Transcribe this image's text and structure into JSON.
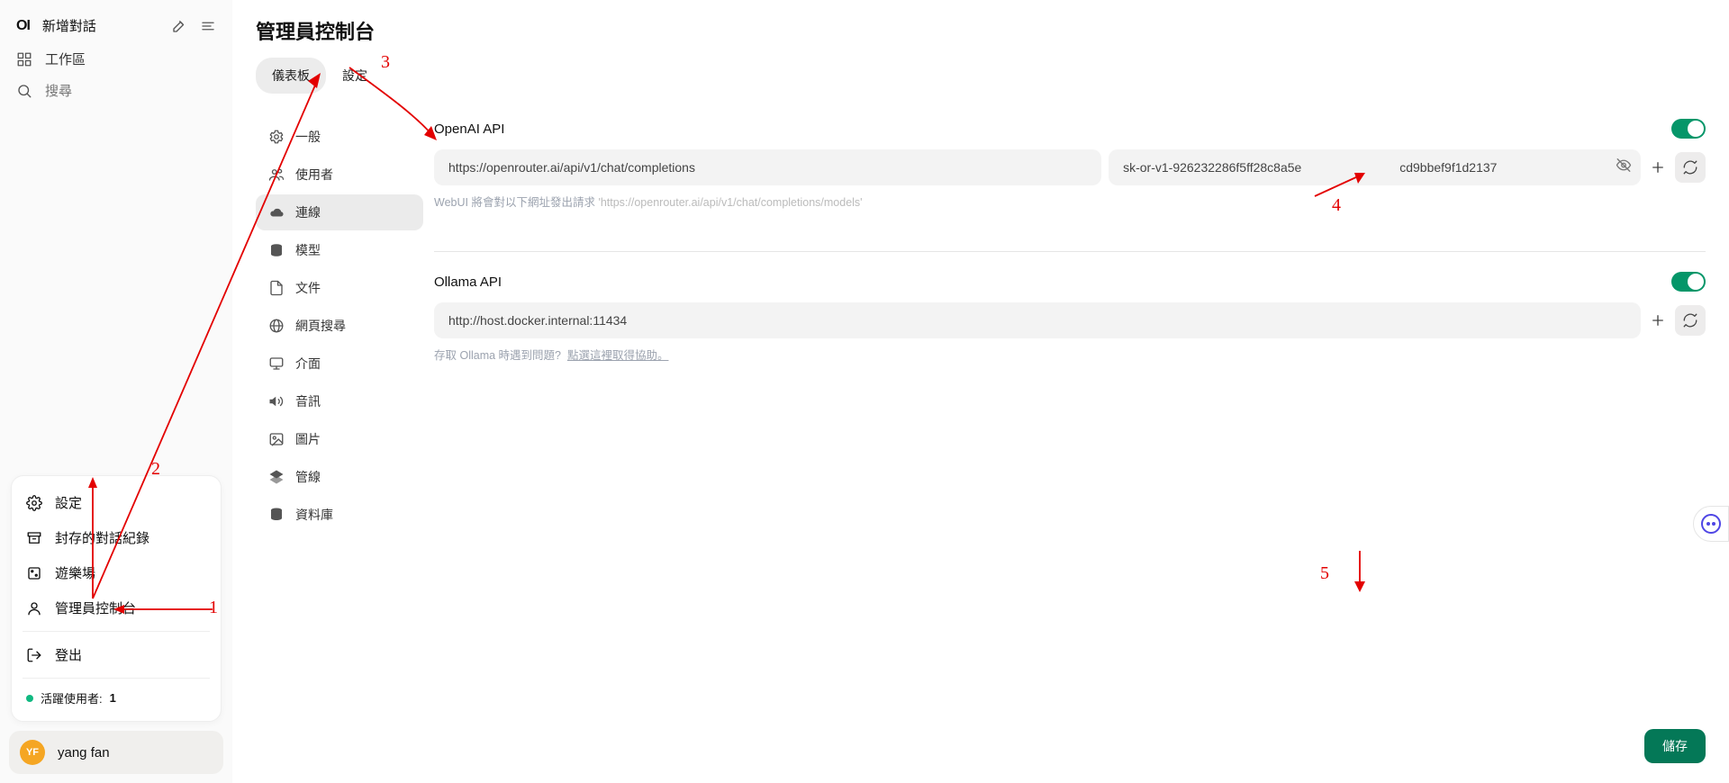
{
  "sidebar": {
    "app_icon": "OI",
    "new_chat": "新增對話",
    "workspace": "工作區",
    "search_placeholder": "搜尋"
  },
  "popup": {
    "settings": "設定",
    "archived": "封存的對話紀錄",
    "playground": "遊樂場",
    "admin_console": "管理員控制台",
    "sign_out": "登出",
    "active_users_label": "活躍使用者:",
    "active_users_count": "1"
  },
  "user": {
    "initials": "YF",
    "name": "yang fan"
  },
  "page": {
    "title": "管理員控制台",
    "tabs": {
      "dashboard": "儀表板",
      "settings": "設定"
    },
    "save": "儲存"
  },
  "settings_nav": [
    {
      "key": "general",
      "label": "一般",
      "icon": "gear"
    },
    {
      "key": "users",
      "label": "使用者",
      "icon": "users"
    },
    {
      "key": "connect",
      "label": "連線",
      "icon": "cloud",
      "selected": true
    },
    {
      "key": "models",
      "label": "模型",
      "icon": "stack"
    },
    {
      "key": "docs",
      "label": "文件",
      "icon": "doc"
    },
    {
      "key": "web",
      "label": "網頁搜尋",
      "icon": "globe"
    },
    {
      "key": "ui",
      "label": "介面",
      "icon": "monitor"
    },
    {
      "key": "audio",
      "label": "音訊",
      "icon": "sound"
    },
    {
      "key": "images",
      "label": "圖片",
      "icon": "image"
    },
    {
      "key": "pipelines",
      "label": "管線",
      "icon": "layers"
    },
    {
      "key": "database",
      "label": "資料庫",
      "icon": "db"
    }
  ],
  "apis": {
    "openai": {
      "title": "OpenAI API",
      "url": "https://openrouter.ai/api/v1/chat/completions",
      "key": "sk-or-v1-926232286f5ff28c8a5e                            cd9bbef9f1d2137",
      "hint_prefix": "WebUI 將會對以下網址發出請求",
      "hint_url": "'https://openrouter.ai/api/v1/chat/completions/models'"
    },
    "ollama": {
      "title": "Ollama API",
      "url": "http://host.docker.internal:11434",
      "hint_prefix": "存取 Ollama 時遇到問題?",
      "hint_link": "點選這裡取得協助。"
    }
  },
  "annotations": {
    "n1": "1",
    "n2": "2",
    "n3": "3",
    "n4": "4",
    "n5": "5"
  }
}
